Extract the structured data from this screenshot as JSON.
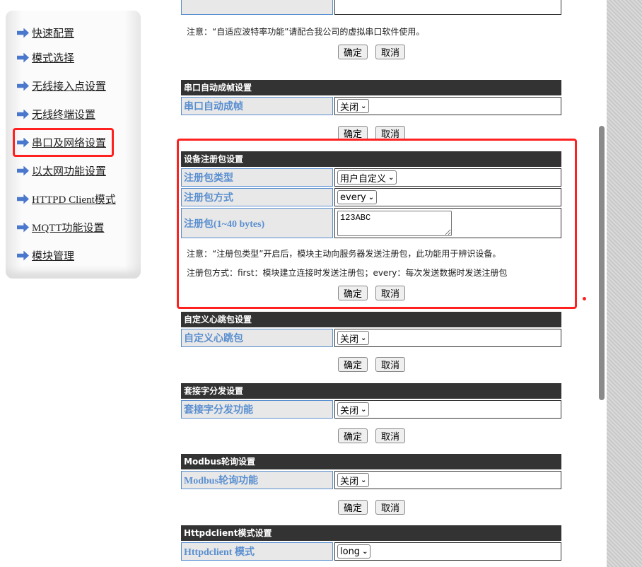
{
  "sidebar": {
    "items": [
      {
        "label": "快速配置"
      },
      {
        "label": "模式选择"
      },
      {
        "label": "无线接入点设置"
      },
      {
        "label": "无线终端设置"
      },
      {
        "label": "串口及网络设置",
        "highlighted": true
      },
      {
        "label": "以太网功能设置"
      },
      {
        "label": "HTTPD Client模式"
      },
      {
        "label": "MQTT功能设置"
      },
      {
        "label": "模块管理"
      }
    ]
  },
  "buttons": {
    "ok": "确定",
    "cancel": "取消"
  },
  "top_note": "注意：“自适应波特率功能”请配合我公司的虚拟串口软件使用。",
  "sections": [
    {
      "title": "串口自动成帧设置",
      "rows": [
        {
          "label": "串口自动成帧",
          "type": "select",
          "value": "关闭"
        }
      ]
    },
    {
      "title": "设备注册包设置",
      "highlighted": true,
      "rows": [
        {
          "label": "注册包类型",
          "type": "select",
          "value": "用户自定义"
        },
        {
          "label": "注册包方式",
          "type": "select",
          "value": "every"
        },
        {
          "label": "注册包(1~40 bytes)",
          "type": "textarea",
          "value": "123ABC"
        }
      ],
      "notes": [
        "注意：“注册包类型”开启后，模块主动向服务器发送注册包，此功能用于辨识设备。",
        "注册包方式：first：模块建立连接时发送注册包；every：每次发送数据时发送注册包"
      ]
    },
    {
      "title": "自定义心跳包设置",
      "rows": [
        {
          "label": "自定义心跳包",
          "type": "select",
          "value": "关闭"
        }
      ]
    },
    {
      "title": "套接字分发设置",
      "rows": [
        {
          "label": "套接字分发功能",
          "type": "select",
          "value": "关闭"
        }
      ]
    },
    {
      "title": "Modbus轮询设置",
      "rows": [
        {
          "label": "Modbus轮询功能",
          "type": "select",
          "value": "关闭"
        }
      ]
    },
    {
      "title": "Httpdclient模式设置",
      "rows": [
        {
          "label": "Httpdclient 模式",
          "type": "select",
          "value": "long"
        }
      ]
    }
  ],
  "colors": {
    "highlight": "#ff2020",
    "header_bg": "#333333",
    "label_color": "#5a8fd0"
  }
}
